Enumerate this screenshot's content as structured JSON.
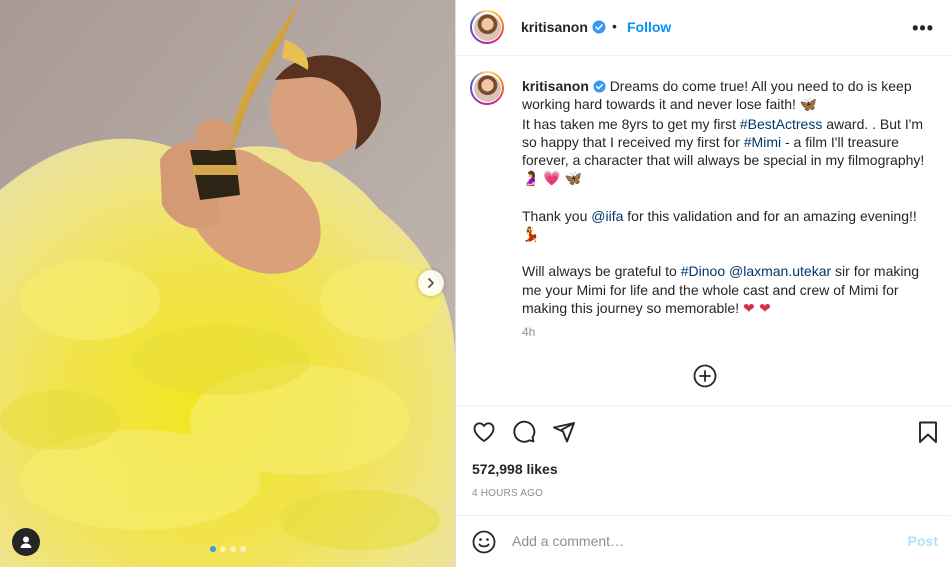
{
  "post": {
    "username": "kritisanon",
    "follow_label": "Follow",
    "separator": "•",
    "more_label": "•••",
    "caption": {
      "line1": "Dreams do come true! All you need to do is keep working hard towards it and never lose faith!",
      "line2a": "It has taken me 8yrs to get my first",
      "hashtag1": "#BestActress",
      "line2b": "award. . But I'm so happy that I received my first for",
      "hashtag2": "#Mimi",
      "line2c": "- a film I'll treasure forever, a character that will always be special in my filmography!",
      "line3a": "Thank you",
      "mention1": "@iifa",
      "line3b": "for this validation and for an amazing evening!!",
      "line4a": "Will always be grateful to",
      "hashtag3": "#Dinoo",
      "mention2": "@laxman.utekar",
      "line4b": "sir for making me your Mimi for life and the whole cast and crew of Mimi for making this journey so memorable!",
      "emoji_butterfly": "🦋",
      "emoji_dancer": "💃",
      "emoji_hearts": "❤ ❤",
      "emoji_heart": "💗",
      "emoji_woman": "🤰"
    },
    "caption_time": "4h",
    "likes": "572,998 likes",
    "time_ago": "4 HOURS AGO",
    "comment_placeholder": "Add a comment…",
    "post_label": "Post"
  },
  "media": {
    "slide_count": 4,
    "active_slide": 1
  },
  "icons": {
    "like": "heart-icon",
    "comment": "comment-icon",
    "share": "share-icon",
    "save": "bookmark-icon",
    "emoji": "emoji-icon",
    "tag": "user-tag-icon",
    "next": "chevron-right-icon",
    "add": "add-circle-icon",
    "verified": "verified-badge-icon"
  },
  "colors": {
    "accent": "#0095f6",
    "link": "#00376b",
    "muted": "#8e8e8e",
    "post_disabled": "#b2dffc",
    "dress": "#f5e23a"
  }
}
